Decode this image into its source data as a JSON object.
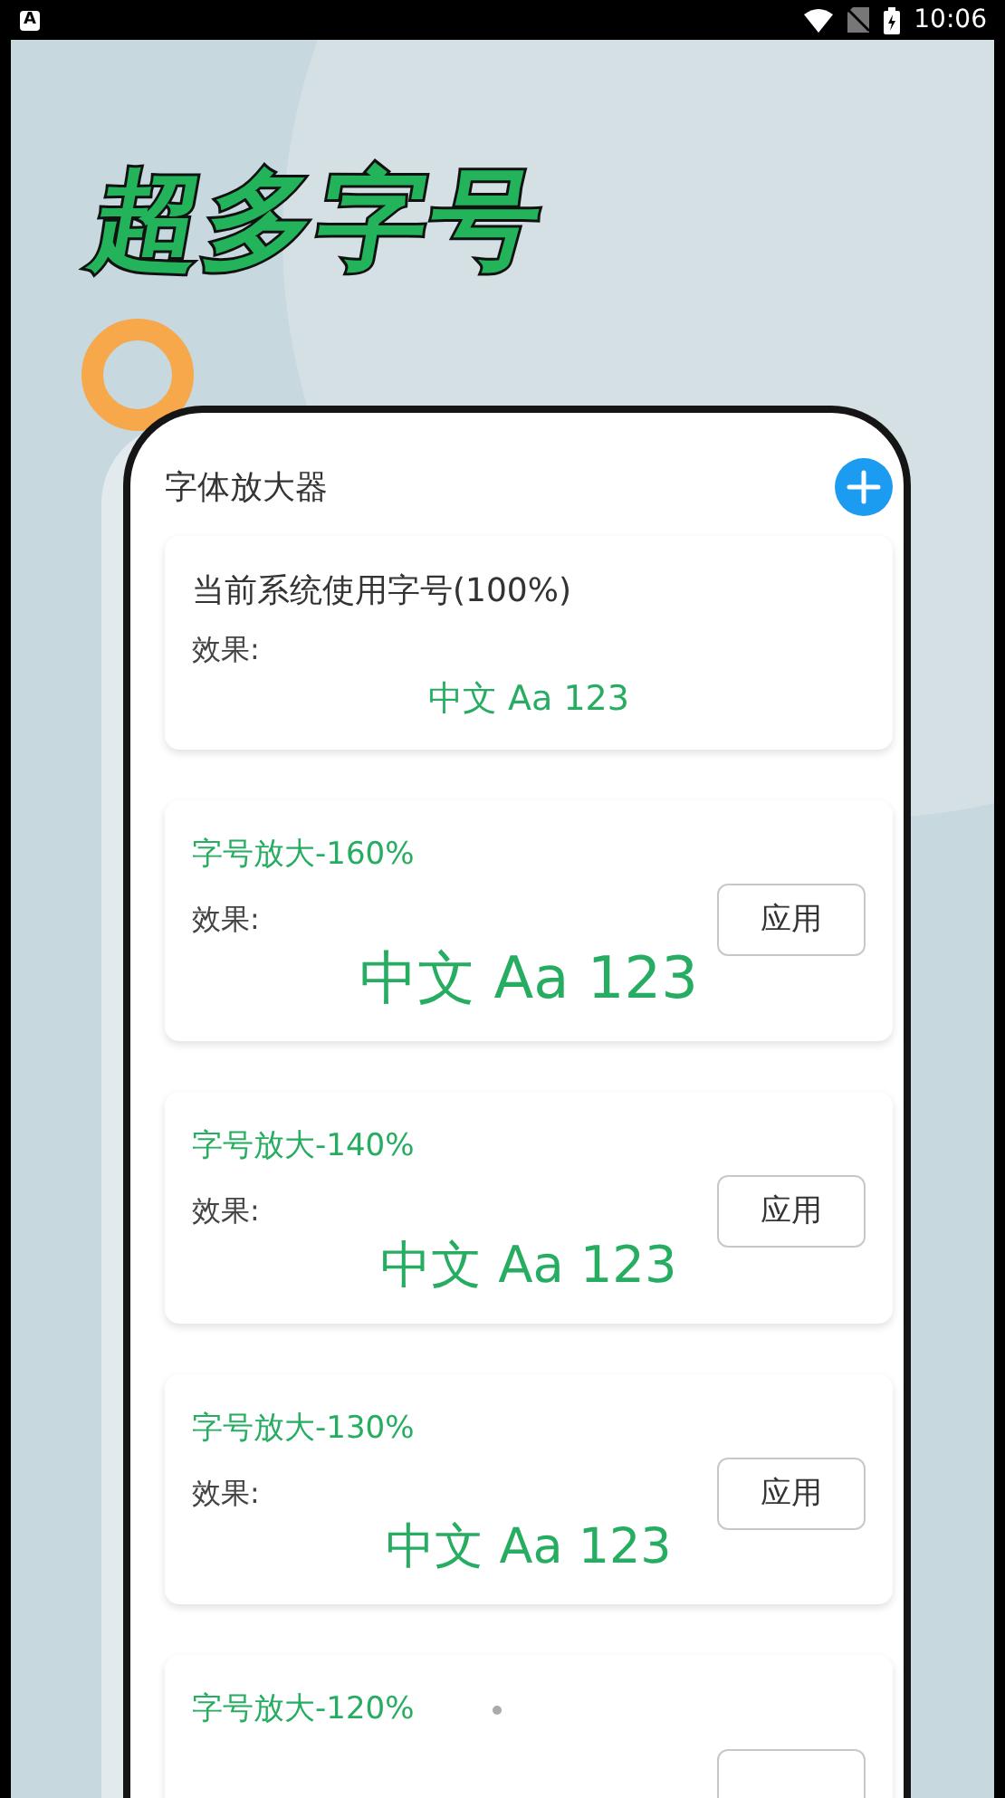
{
  "status_bar": {
    "notification_icon": "A",
    "time": "10:06"
  },
  "banner": {
    "title": "超多字号"
  },
  "app": {
    "title": "字体放大器",
    "cards": [
      {
        "kind": "current",
        "heading": "当前系统使用字号(100%)",
        "effect_label": "效果:",
        "sample": "中文 Aa 123"
      },
      {
        "kind": "preset",
        "heading": "字号放大-160%",
        "effect_label": "效果:",
        "sample": "中文 Aa 123",
        "button": "应用"
      },
      {
        "kind": "preset",
        "heading": "字号放大-140%",
        "effect_label": "效果:",
        "sample": "中文 Aa 123",
        "button": "应用"
      },
      {
        "kind": "preset",
        "heading": "字号放大-130%",
        "effect_label": "效果:",
        "sample": "中文 Aa 123",
        "button": "应用"
      },
      {
        "kind": "partial",
        "heading": "字号放大-120%"
      }
    ]
  }
}
